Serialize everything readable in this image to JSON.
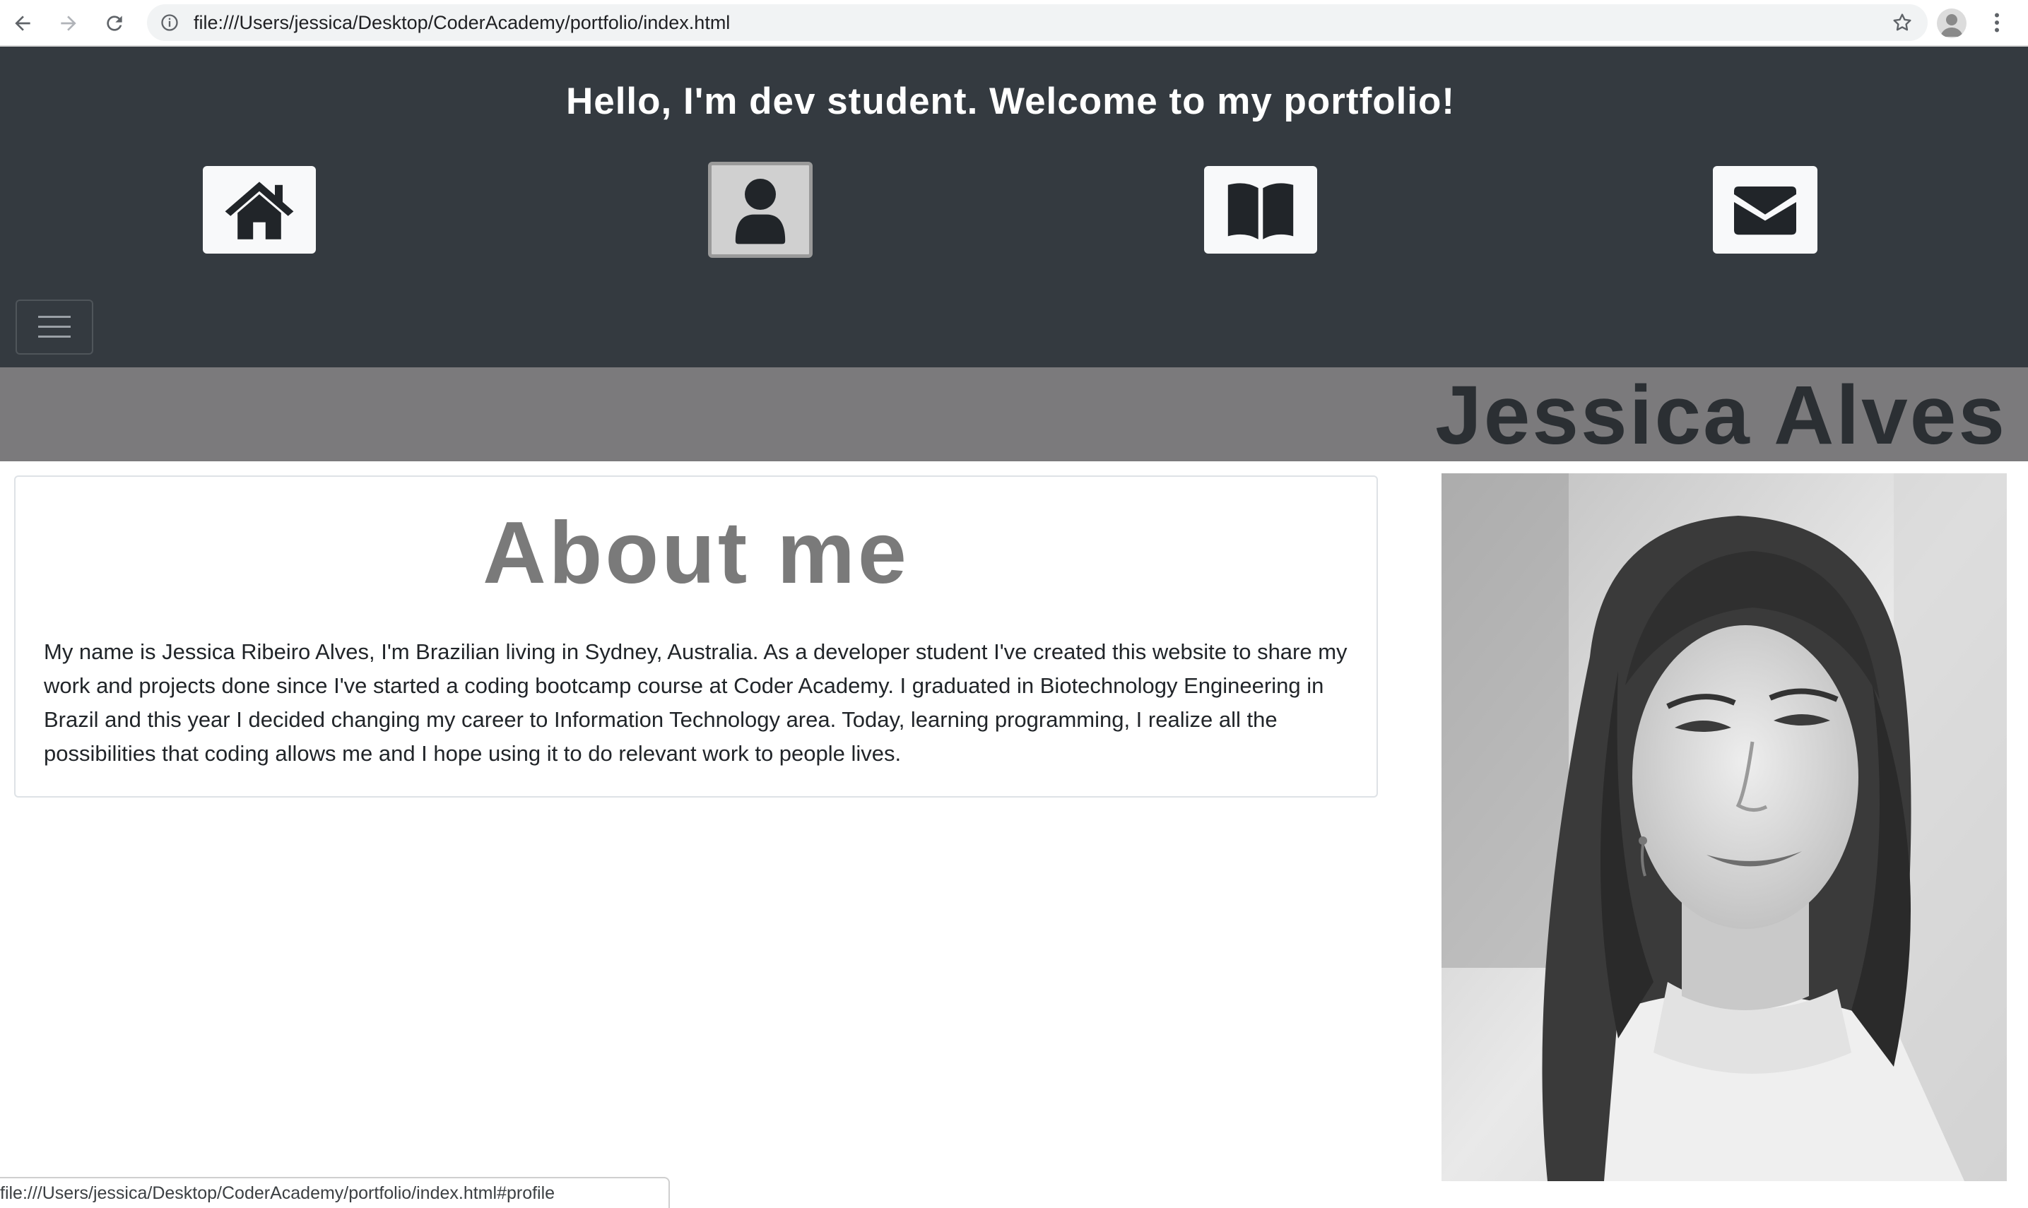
{
  "browser": {
    "url": "file:///Users/jessica/Desktop/CoderAcademy/portfolio/index.html",
    "status_url": "file:///Users/jessica/Desktop/CoderAcademy/portfolio/index.html#profile",
    "icons": [
      "back-arrow-icon",
      "forward-arrow-icon",
      "reload-icon",
      "info-icon",
      "bookmark-star-icon",
      "profile-icon",
      "menu-kebab-icon"
    ]
  },
  "header": {
    "greeting": "Hello, I'm dev student. Welcome to my portfolio!",
    "nav_icons": [
      "home-icon",
      "user-icon",
      "book-icon",
      "envelope-icon"
    ],
    "active_icon": "user-icon",
    "toggler_icon": "hamburger-icon",
    "background": "#343a40"
  },
  "banner": {
    "name": "Jessica Alves",
    "background": "#7b7a7c"
  },
  "about": {
    "title": "About me",
    "bio": "My name is Jessica Ribeiro Alves, I'm Brazilian living in Sydney, Australia. As a developer student I've created this website to share my work and projects done since I've started a coding bootcamp course at Coder Academy. I graduated in Biotechnology Engineering in Brazil and this year I decided changing my career to Information Technology area. Today, learning programming, I realize all the possibilities that coding allows me and I hope using it to do relevant work to people lives."
  },
  "photo": {
    "subject": "black-and-white portrait photo"
  }
}
